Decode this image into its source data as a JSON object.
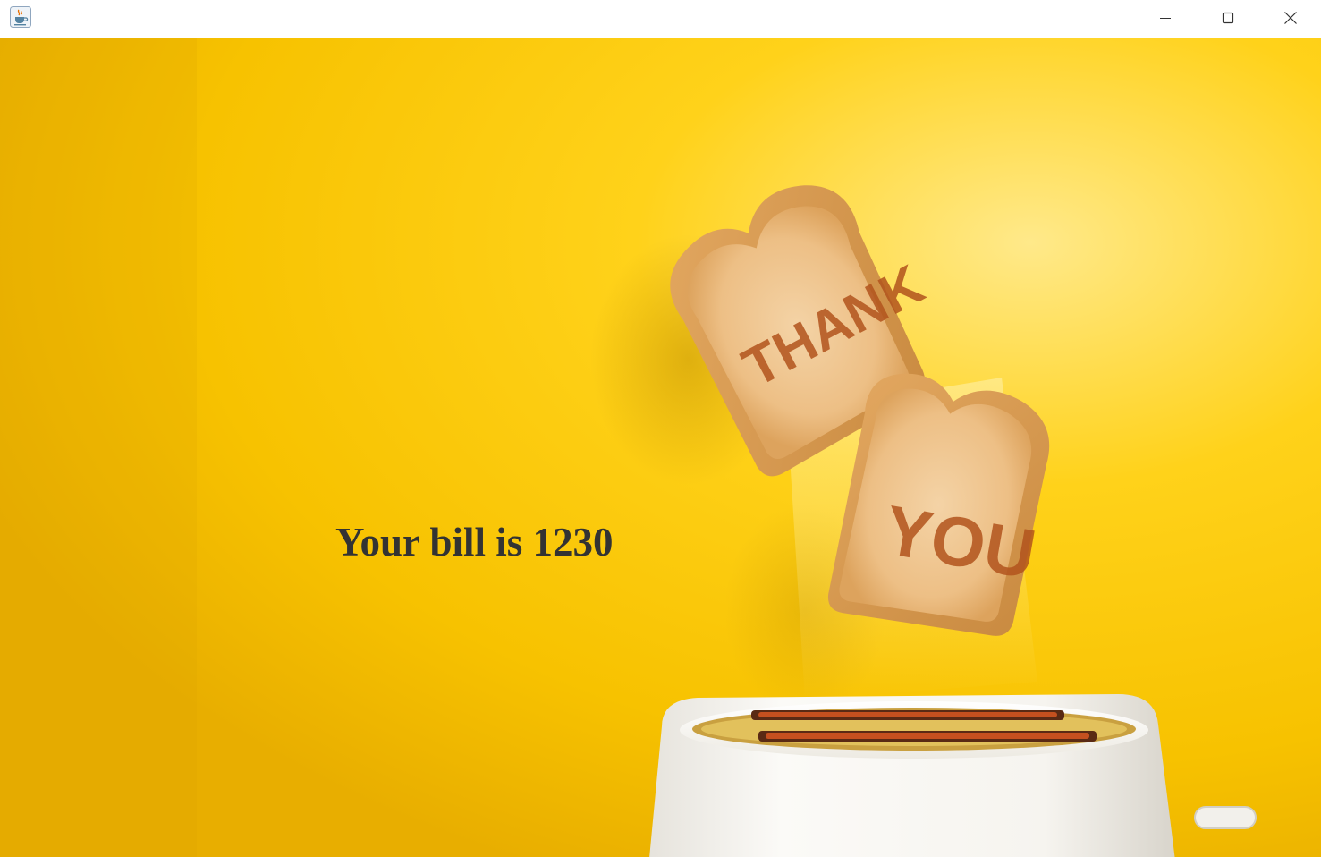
{
  "window": {
    "app_icon": "java-cup-icon",
    "controls": {
      "minimize": "minimize-icon",
      "maximize": "maximize-icon",
      "close": "close-icon"
    }
  },
  "background": {
    "description_colors": {
      "wall": "#F8C400",
      "wall_highlight": "#FFE46A",
      "toast": "#E9B67A",
      "toaster": "#F3F1EC"
    },
    "toast_words": [
      "THANK",
      "YOU"
    ]
  },
  "main": {
    "bill_text": "Your bill is 1230"
  }
}
